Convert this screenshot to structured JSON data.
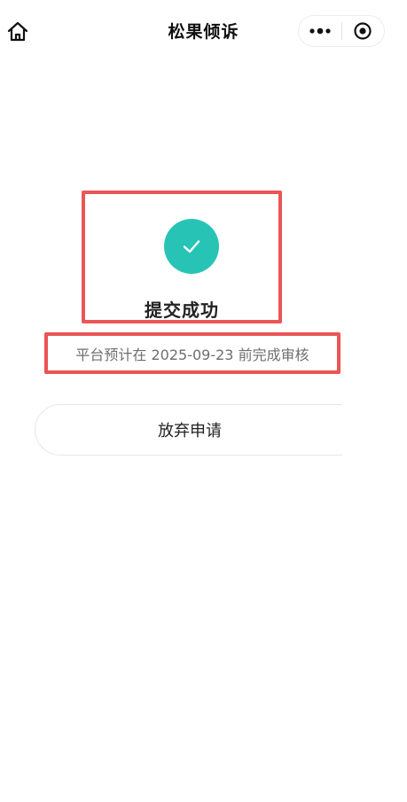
{
  "navbar": {
    "title": "松果倾诉",
    "home_icon": "home-icon",
    "more_icon": "more-dots-icon",
    "close_icon": "target-close-icon"
  },
  "success": {
    "icon": "check-icon",
    "icon_color": "#27c4b6",
    "title": "提交成功"
  },
  "notice": {
    "text": "平台预计在 2025-09-23 前完成审核"
  },
  "actions": {
    "abandon_label": "放弃申请"
  },
  "colors": {
    "highlight_border": "#ea5556",
    "accent": "#27c4b6"
  }
}
